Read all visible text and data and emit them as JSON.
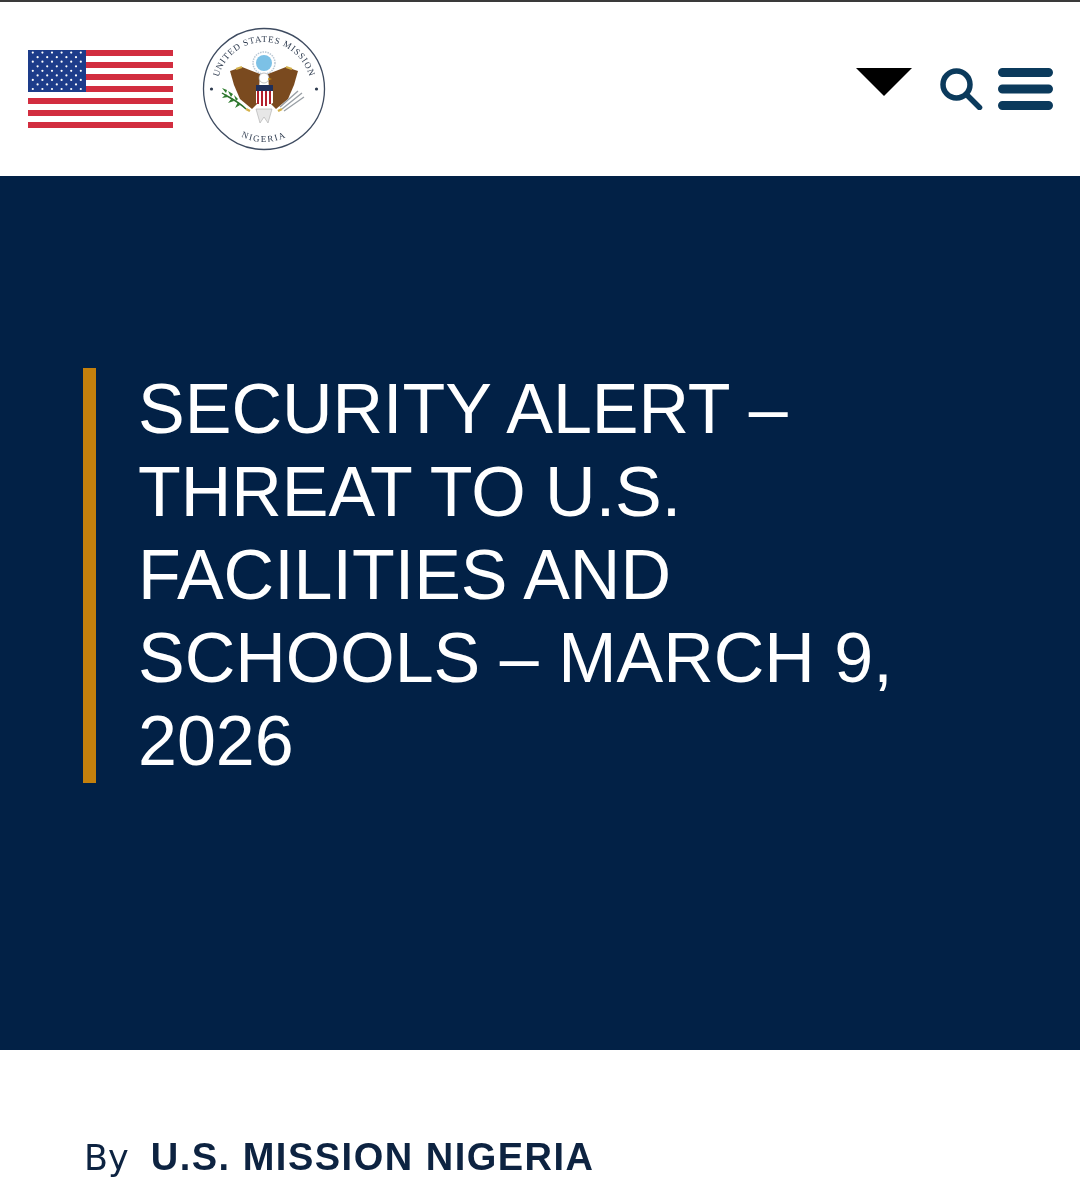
{
  "header": {
    "seal": {
      "top_text": "UNITED STATES MISSION",
      "bottom_text": "NIGERIA"
    }
  },
  "hero": {
    "title": "SECURITY ALERT – THREAT TO U.S. FACILITIES AND SCHOOLS – MARCH 9, 2026"
  },
  "byline": {
    "label": "By",
    "author": "U.S. MISSION NIGERIA"
  }
}
